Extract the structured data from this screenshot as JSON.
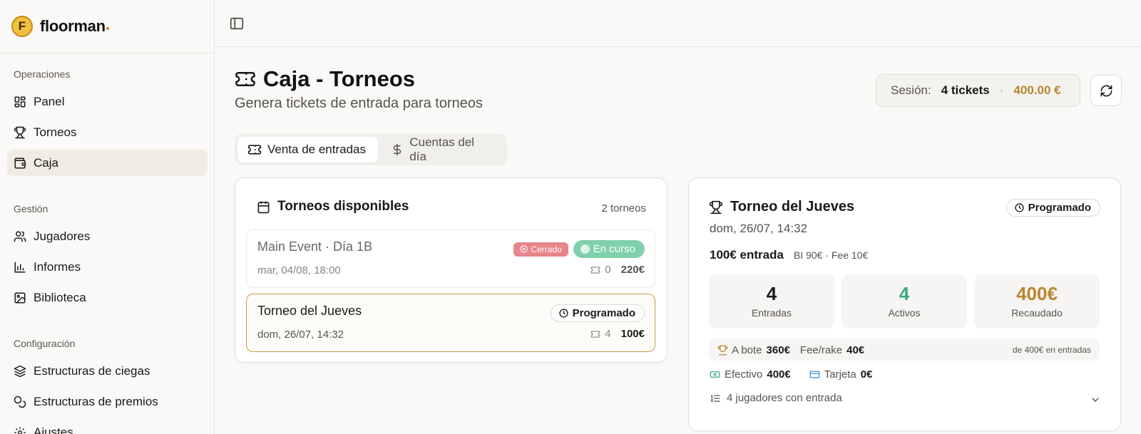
{
  "brand": {
    "name": "floorman",
    "logo_letter": "F"
  },
  "sidebar": {
    "groups": [
      {
        "title": "Operaciones",
        "items": [
          {
            "label": "Panel",
            "icon": "dashboard-icon"
          },
          {
            "label": "Torneos",
            "icon": "trophy-icon"
          },
          {
            "label": "Caja",
            "icon": "wallet-icon",
            "active": true
          }
        ]
      },
      {
        "title": "Gestión",
        "items": [
          {
            "label": "Jugadores",
            "icon": "users-icon"
          },
          {
            "label": "Informes",
            "icon": "bar-chart-icon"
          },
          {
            "label": "Biblioteca",
            "icon": "image-icon"
          }
        ]
      },
      {
        "title": "Configuración",
        "items": [
          {
            "label": "Estructuras de ciegas",
            "icon": "layers-icon"
          },
          {
            "label": "Estructuras de premios",
            "icon": "coins-icon"
          },
          {
            "label": "Ajustes",
            "icon": "gear-icon"
          }
        ]
      }
    ]
  },
  "header": {
    "title": "Caja - Torneos",
    "subtitle": "Genera tickets de entrada para torneos",
    "session": {
      "label": "Sesión:",
      "tickets": "4 tickets",
      "separator": "·",
      "amount": "400.00 €"
    }
  },
  "tabs": [
    {
      "label": "Venta de entradas",
      "icon": "ticket-icon",
      "active": true
    },
    {
      "label": "Cuentas del día",
      "icon": "dollar-icon",
      "active": false
    }
  ],
  "available": {
    "title": "Torneos disponibles",
    "count": "2 torneos",
    "tournaments": [
      {
        "name": "Main Event · Día 1B",
        "date": "mar, 04/08, 18:00",
        "badge_closed": "Cerrado",
        "badge_status": "En curso",
        "tickets": "0",
        "price": "220€"
      },
      {
        "name": "Torneo del Jueves",
        "date": "dom, 26/07, 14:32",
        "badge_status": "Programado",
        "tickets": "4",
        "price": "100€"
      }
    ]
  },
  "detail": {
    "title": "Torneo del Jueves",
    "date": "dom, 26/07, 14:32",
    "status": "Programado",
    "entry": "100€ entrada",
    "breakdown": "BI 90€ · Fee 10€",
    "stats": [
      {
        "value": "4",
        "label": "Entradas",
        "color": "#1c1917"
      },
      {
        "value": "4",
        "label": "Activos",
        "color": "#3aaa78"
      },
      {
        "value": "400€",
        "label": "Recaudado",
        "color": "#b8862e"
      }
    ],
    "pot_label": "A bote",
    "pot_value": "360€",
    "fee_label": "Fee/rake",
    "fee_value": "40€",
    "pot_note": "de 400€ en entradas",
    "cash_label": "Efectivo",
    "cash_value": "400€",
    "card_label": "Tarjeta",
    "card_value": "0€",
    "players": "4 jugadores con entrada"
  },
  "colors": {
    "accent": "#b8862e",
    "success": "#7fd0ab",
    "danger": "#e7858b",
    "active_nav": "#f1ece3"
  }
}
